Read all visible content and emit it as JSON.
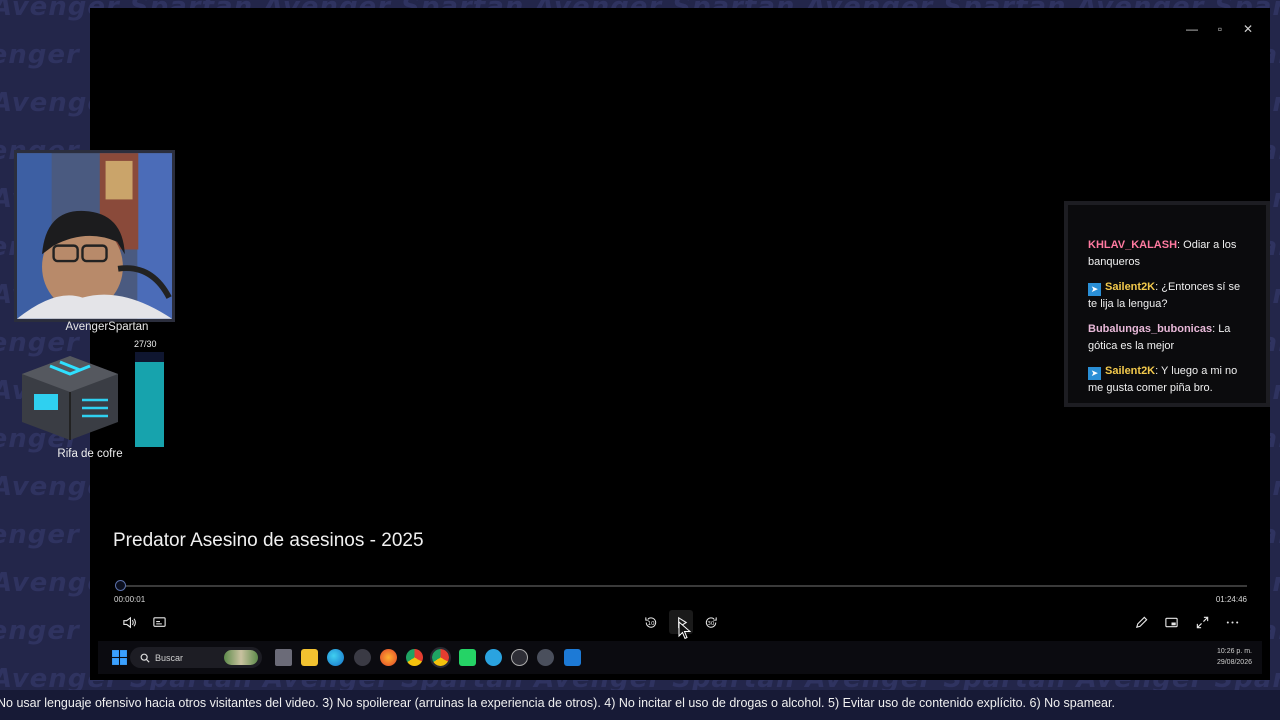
{
  "watermark": {
    "text": "Avenger Spartan"
  },
  "player": {
    "video_title": "Predator Asesino de asesinos - 2025",
    "time_current": "00:00:01",
    "time_total": "01:24:46",
    "progress": 0.0002,
    "window_controls": [
      "minimize",
      "restore",
      "close"
    ],
    "controls": {
      "left": [
        "volume-icon",
        "subtitles-icon"
      ],
      "center": {
        "skip_back": "10",
        "play": "play-icon",
        "skip_forward": "30"
      },
      "right": [
        "edit-icon",
        "miniplayer-icon",
        "fullscreen-icon",
        "more-icon"
      ]
    }
  },
  "taskbar": {
    "search_placeholder": "Buscar",
    "clock_time": "10:26 p. m.",
    "clock_date": "29/08/2026",
    "apps": [
      "start-icon",
      "task-view-icon",
      "file-explorer-icon",
      "edge-icon",
      "settings-icon",
      "firefox-icon",
      "chrome-icon",
      "chrome-alt-icon",
      "whatsapp-icon",
      "telegram-icon",
      "app-icon",
      "gear-icon",
      "media-player-icon"
    ]
  },
  "overlay": {
    "webcam_name": "AvengerSpartan",
    "raffle": {
      "count_label": "27/30",
      "filled": 27,
      "total": 30,
      "label": "Rifa de cofre"
    }
  },
  "chat": {
    "messages": [
      {
        "user": "KHLAV_KALASH",
        "user_color": "#ff7aa0",
        "badge": false,
        "text": ": Odiar a los banqueros"
      },
      {
        "user": "Sailent2K",
        "user_color": "#f2c94c",
        "badge": true,
        "text": ": ¿Entonces sí se te lija la lengua?"
      },
      {
        "user": "Bubalungas_bubonicas",
        "user_color": "#e8b8d8",
        "badge": false,
        "text": ": La gótica es la mejor"
      },
      {
        "user": "Sailent2K",
        "user_color": "#f2c94c",
        "badge": true,
        "text": ": Y luego a mi no me gusta comer piña bro."
      }
    ]
  },
  "ticker": {
    "text": "No usar lenguaje ofensivo hacia otros visitantes del video.   3) No spoilerear (arruinas la experiencia de otros).   4) No incitar el uso de drogas o alcohol.   5) Evitar uso de contenido explícito.   6) No spamear."
  }
}
